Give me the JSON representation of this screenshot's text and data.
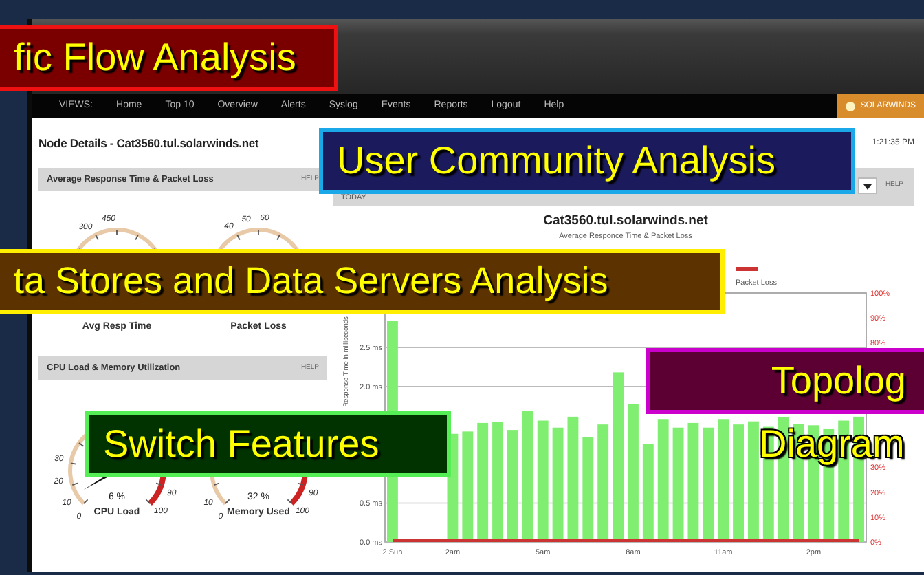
{
  "window": {
    "nav": [
      "VIEWS:",
      "Home",
      "Top 10",
      "Overview",
      "Alerts",
      "Syslog",
      "Events",
      "Reports",
      "Logout",
      "Help"
    ],
    "brand": "SOLARWINDS",
    "page_title": "Node Details - Cat3560.tul.solarwinds.net",
    "time": "1:21:35 PM"
  },
  "left_panels": [
    {
      "title": "Average Response Time & Packet Loss",
      "help": "HELP",
      "gauges": [
        {
          "label": "Avg Resp Time",
          "ticks": [
            "300",
            "450"
          ]
        },
        {
          "label": "Packet Loss",
          "ticks": [
            "40",
            "50",
            "60"
          ]
        }
      ]
    },
    {
      "title": "CPU Load & Memory Utilization",
      "help": "HELP",
      "gauges": [
        {
          "label": "CPU Load",
          "reading": "6 %",
          "ticks": [
            "30",
            "20",
            "10",
            "0",
            "90",
            "100"
          ]
        },
        {
          "label": "Memory Used",
          "reading": "32 %",
          "ticks": [
            "10",
            "0",
            "90",
            "100"
          ]
        }
      ]
    }
  ],
  "chart_panel": {
    "period": "TODAY",
    "help": "HELP",
    "subtitle": "Average Responce Time & Packet Loss",
    "chart_data": {
      "type": "bar",
      "title": "Cat3560.tul.solarwinds.net",
      "ylabel": "Response Time in milliseconds",
      "categories": [
        "2 Sun",
        null,
        null,
        null,
        "2am",
        null,
        null,
        null,
        null,
        null,
        "5am",
        null,
        null,
        null,
        null,
        null,
        "8am",
        null,
        null,
        null,
        null,
        null,
        "11am",
        null,
        null,
        null,
        null,
        null,
        "2pm",
        null,
        null,
        null
      ],
      "ylim": [
        0,
        3.2
      ],
      "y2lim": [
        0,
        100
      ],
      "grid": true,
      "yticks": [
        {
          "value": 0,
          "label": "0.0 ms"
        },
        {
          "value": 0.5,
          "label": "0.5 ms"
        },
        {
          "value": 2,
          "label": "2.0 ms"
        },
        {
          "value": 2.5,
          "label": "2.5 ms"
        }
      ],
      "y2ticks": [
        {
          "value": 0,
          "label": "0%"
        },
        {
          "value": 10,
          "label": "10%"
        },
        {
          "value": 20,
          "label": "20%"
        },
        {
          "value": 30,
          "label": "30%"
        },
        {
          "value": 80,
          "label": "80%"
        },
        {
          "value": 90,
          "label": "90%"
        },
        {
          "value": 100,
          "label": "100%"
        }
      ],
      "series": [
        {
          "color": "#80ee70",
          "values": [
            2.84,
            null,
            null,
            null,
            1.39,
            1.42,
            1.53,
            1.54,
            1.44,
            1.68,
            1.56,
            1.47,
            1.61,
            1.35,
            1.51,
            2.18,
            1.77,
            1.26,
            1.58,
            1.47,
            1.53,
            1.47,
            1.58,
            1.51,
            1.55,
            1.48,
            1.6,
            1.52,
            1.5,
            1.45,
            1.56,
            1.61
          ]
        },
        {
          "name": "Packet Loss",
          "color": "#cc3333",
          "values": [
            0,
            0,
            0,
            0,
            0,
            0,
            0,
            0,
            0,
            0,
            0,
            0,
            0,
            0,
            0,
            0,
            0,
            0,
            0,
            0,
            0,
            0,
            0,
            0,
            0,
            0,
            0,
            0,
            0,
            0,
            0,
            0
          ]
        }
      ]
    }
  },
  "callouts": [
    {
      "kind": "traffic",
      "text": "fic Flow Analysis",
      "color": "#7a0000"
    },
    {
      "kind": "community",
      "text": "User Community Analysis",
      "color": "#1a1a5c"
    },
    {
      "kind": "storage",
      "text": "ta Stores and Data Servers Analysis",
      "color": "#5c3300"
    },
    {
      "kind": "switch",
      "text": "Switch Features",
      "color": "#003300"
    },
    {
      "kind": "topology",
      "text": "Topolog",
      "second_line": "Diagram",
      "color": "#5c0033"
    }
  ]
}
